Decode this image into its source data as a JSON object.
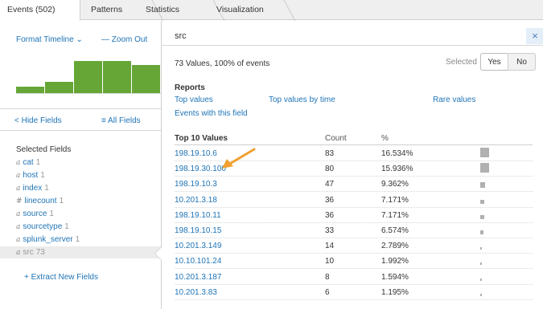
{
  "tabs": [
    {
      "label": "Events (502)",
      "active": true
    },
    {
      "label": "Patterns",
      "active": false
    },
    {
      "label": "Statistics",
      "active": false
    },
    {
      "label": "Visualization",
      "active": false
    }
  ],
  "timeline": {
    "format_label": "Format Timeline ⌄",
    "zoom_label": "— Zoom Out",
    "histogram_relative_heights": [
      0.18,
      0.3,
      0.85,
      0.85,
      0.75
    ],
    "bar_color": "#65a637"
  },
  "sidebar": {
    "hide_fields_label": "< Hide Fields",
    "all_fields_label": "≡ All Fields",
    "selected_title": "Selected Fields",
    "fields": [
      {
        "type": "a",
        "name": "cat",
        "count": "1"
      },
      {
        "type": "a",
        "name": "host",
        "count": "1"
      },
      {
        "type": "a",
        "name": "index",
        "count": "1"
      },
      {
        "type": "#",
        "name": "linecount",
        "count": "1"
      },
      {
        "type": "a",
        "name": "source",
        "count": "1"
      },
      {
        "type": "a",
        "name": "sourcetype",
        "count": "1"
      },
      {
        "type": "a",
        "name": "splunk_server",
        "count": "1"
      },
      {
        "type": "a",
        "name": "src",
        "count": "73",
        "selected": true
      }
    ],
    "extract_label": "+ Extract New Fields"
  },
  "panel": {
    "title": "src",
    "close_label": "×",
    "summary": "73 Values, 100% of events",
    "selected_label": "Selected",
    "yes_label": "Yes",
    "no_label": "No",
    "reports_title": "Reports",
    "reports": {
      "top_values": "Top values",
      "top_values_by_time": "Top values by time",
      "rare_values": "Rare values",
      "events_with_field": "Events with this field"
    },
    "table": {
      "headers": {
        "value": "Top 10 Values",
        "count": "Count",
        "percent": "%"
      },
      "rows": [
        {
          "value": "198.19.10.6",
          "count": "83",
          "percent": "16.534%",
          "pct": 16.534
        },
        {
          "value": "198.19.30.100",
          "count": "80",
          "percent": "15.936%",
          "pct": 15.936
        },
        {
          "value": "198.19.10.3",
          "count": "47",
          "percent": "9.362%",
          "pct": 9.362
        },
        {
          "value": "10.201.3.18",
          "count": "36",
          "percent": "7.171%",
          "pct": 7.171
        },
        {
          "value": "198.19.10.11",
          "count": "36",
          "percent": "7.171%",
          "pct": 7.171
        },
        {
          "value": "198.19.10.15",
          "count": "33",
          "percent": "6.574%",
          "pct": 6.574
        },
        {
          "value": "10.201.3.149",
          "count": "14",
          "percent": "2.789%",
          "pct": 2.789
        },
        {
          "value": "10.10.101.24",
          "count": "10",
          "percent": "1.992%",
          "pct": 1.992
        },
        {
          "value": "10.201.3.187",
          "count": "8",
          "percent": "1.594%",
          "pct": 1.594
        },
        {
          "value": "10.201.3.83",
          "count": "6",
          "percent": "1.195%",
          "pct": 1.195
        }
      ]
    }
  },
  "annotation": {
    "arrow_color": "#f0a030"
  }
}
